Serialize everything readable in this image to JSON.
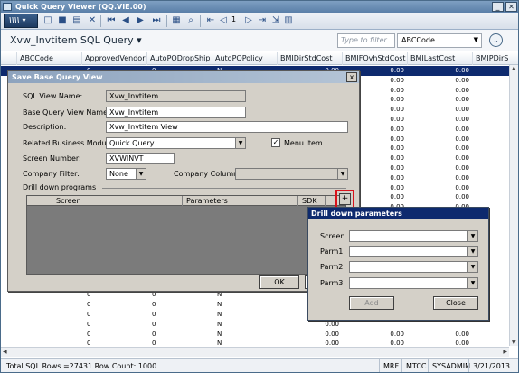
{
  "window": {
    "title": "Quick Query Viewer (QQ.VIE.00)"
  },
  "toolbar": {
    "logo": "\\\\\\\\",
    "page_number": "1"
  },
  "header": {
    "view_title": "Xvw_Invtitem SQL Query",
    "title_caret": "▾",
    "filter_placeholder": "Type to filter",
    "filter_column": "ABCCode",
    "expand_symbol": "⌄"
  },
  "grid": {
    "columns": [
      "ABCCode",
      "ApprovedVendor",
      "AutoPODropShip",
      "AutoPOPolicy",
      "BMIDirStdCost",
      "BMIFOvhStdCost",
      "BMILastCost",
      "BMIPDirS"
    ],
    "rows": [
      {
        "b": "0",
        "c": "0",
        "d": "N",
        "e": "0.00",
        "f": "0.00",
        "g": "0.00"
      },
      {
        "b": "",
        "c": "",
        "d": "",
        "e": "",
        "f": "0.00",
        "g": "0.00"
      },
      {
        "b": "",
        "c": "",
        "d": "",
        "e": "",
        "f": "0.00",
        "g": "0.00"
      },
      {
        "b": "",
        "c": "",
        "d": "",
        "e": "",
        "f": "0.00",
        "g": "0.00"
      },
      {
        "b": "",
        "c": "",
        "d": "",
        "e": "",
        "f": "0.00",
        "g": "0.00"
      },
      {
        "b": "",
        "c": "",
        "d": "",
        "e": "",
        "f": "0.00",
        "g": "0.00"
      },
      {
        "b": "",
        "c": "",
        "d": "",
        "e": "",
        "f": "0.00",
        "g": "0.00"
      },
      {
        "b": "",
        "c": "",
        "d": "",
        "e": "",
        "f": "0.00",
        "g": "0.00"
      },
      {
        "b": "",
        "c": "",
        "d": "",
        "e": "",
        "f": "0.00",
        "g": "0.00"
      },
      {
        "b": "",
        "c": "",
        "d": "",
        "e": "",
        "f": "0.00",
        "g": "0.00"
      },
      {
        "b": "",
        "c": "",
        "d": "",
        "e": "",
        "f": "0.00",
        "g": "0.00"
      },
      {
        "b": "",
        "c": "",
        "d": "",
        "e": "",
        "f": "0.00",
        "g": "0.00"
      },
      {
        "b": "",
        "c": "",
        "d": "",
        "e": "",
        "f": "0.00",
        "g": "0.00"
      },
      {
        "b": "",
        "c": "",
        "d": "",
        "e": "",
        "f": "0.00",
        "g": "0.00"
      },
      {
        "b": "",
        "c": "",
        "d": "",
        "e": "",
        "f": "0.00",
        "g": "0.00"
      },
      {
        "b": "",
        "c": "",
        "d": "",
        "e": "",
        "f": "0.00",
        "g": "0.00"
      },
      {
        "b": "",
        "c": "",
        "d": "",
        "e": "",
        "f": "0.00",
        "g": "0.00"
      },
      {
        "b": "",
        "c": "",
        "d": "",
        "e": "",
        "f": "0.00",
        "g": "0.00"
      },
      {
        "b": "",
        "c": "",
        "d": "",
        "e": "",
        "f": "0.00",
        "g": "0.00"
      },
      {
        "b": "",
        "c": "",
        "d": "",
        "e": "",
        "f": "0.00",
        "g": "0.00"
      },
      {
        "b": "",
        "c": "",
        "d": "",
        "e": "",
        "f": "0.00",
        "g": "0.00"
      },
      {
        "b": "",
        "c": "",
        "d": "",
        "e": "",
        "f": "0.00",
        "g": "0.00"
      },
      {
        "b": "",
        "c": "",
        "d": "",
        "e": "",
        "f": "0.00",
        "g": ""
      },
      {
        "b": "0",
        "c": "0",
        "d": "N",
        "e": "0.00",
        "f": "",
        "g": ""
      },
      {
        "b": "0",
        "c": "0",
        "d": "N",
        "e": "0.00",
        "f": "",
        "g": ""
      },
      {
        "b": "0",
        "c": "0",
        "d": "N",
        "e": "0.00",
        "f": "",
        "g": ""
      },
      {
        "b": "0",
        "c": "0",
        "d": "N",
        "e": "0.00",
        "f": "",
        "g": ""
      },
      {
        "b": "0",
        "c": "0",
        "d": "N",
        "e": "0.00",
        "f": "0.00",
        "g": "0.00"
      },
      {
        "b": "0",
        "c": "0",
        "d": "N",
        "e": "0.00",
        "f": "0.00",
        "g": "0.00"
      }
    ]
  },
  "status": {
    "rows_text": "Total SQL Rows =27431  Row Count: 1000",
    "seg1": "MRF",
    "seg2": "MTCC",
    "seg3": "SYSADMIN",
    "seg4": "3/21/2013"
  },
  "save_dialog": {
    "title": "Save Base Query View",
    "close_symbol": "x",
    "sql_view_name_label": "SQL View Name:",
    "sql_view_name_value": "Xvw_Invtitem",
    "base_query_label": "Base Query View Name:",
    "base_query_value": "Xvw_Invtitem",
    "description_label": "Description:",
    "description_value": "Xvw_Invtitem View",
    "module_label": "Related Business Module:",
    "module_value": "Quick Query",
    "menu_item_label": "Menu Item",
    "menu_item_checked": "✓",
    "screen_number_label": "Screen Number:",
    "screen_number_value": "XVWINVT",
    "company_filter_label": "Company Filter:",
    "company_filter_value": "None",
    "company_column_label": "Company Column:",
    "company_column_value": "",
    "drill_group_label": "Drill down programs",
    "drill_columns": [
      "Screen",
      "Parameters",
      "SDK"
    ],
    "plus_label": "+",
    "ok_label": "OK",
    "cancel_label": "C"
  },
  "drill_params_dialog": {
    "title": "Drill down parameters",
    "screen_label": "Screen",
    "parm1_label": "Parm1",
    "parm2_label": "Parm2",
    "parm3_label": "Parm3",
    "add_label": "Add",
    "close_label": "Close"
  }
}
